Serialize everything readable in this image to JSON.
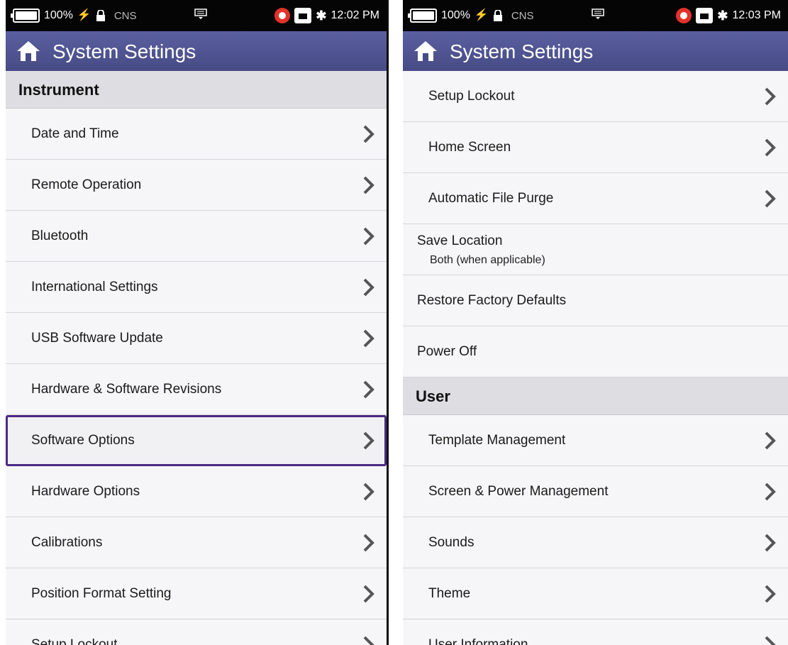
{
  "left": {
    "status": {
      "battery": "100%",
      "carrier": "CNS",
      "time": "12:02 PM"
    },
    "title": "System Settings",
    "section": "Instrument",
    "items": [
      "Date and Time",
      "Remote Operation",
      "Bluetooth",
      "International Settings",
      "USB Software Update",
      "Hardware & Software Revisions",
      "Software Options",
      "Hardware Options",
      "Calibrations",
      "Position Format Setting",
      "Setup Lockout"
    ],
    "selected_item": "Software Options"
  },
  "right": {
    "status": {
      "battery": "100%",
      "carrier": "CNS",
      "time": "12:03 PM"
    },
    "title": "System Settings",
    "items_top": [
      "Setup Lockout",
      "Home Screen",
      "Automatic File Purge"
    ],
    "save_location": {
      "label": "Save Location",
      "value": "Both (when applicable)"
    },
    "restore": "Restore Factory Defaults",
    "power_off": "Power Off",
    "section_user": "User",
    "items_user": [
      "Template Management",
      "Screen & Power Management",
      "Sounds",
      "Theme",
      "User Information"
    ]
  },
  "icons": [
    "battery-icon",
    "lightning-icon",
    "lock-icon",
    "keyboard-icon",
    "location-pin-icon",
    "ethernet-icon",
    "bluetooth-icon",
    "home-icon",
    "chevron-right-icon"
  ],
  "colors": {
    "titlebar": "#4e5290",
    "selected_border": "#4b2a86",
    "section_bg": "#dedee2",
    "status_bg": "#050505"
  }
}
